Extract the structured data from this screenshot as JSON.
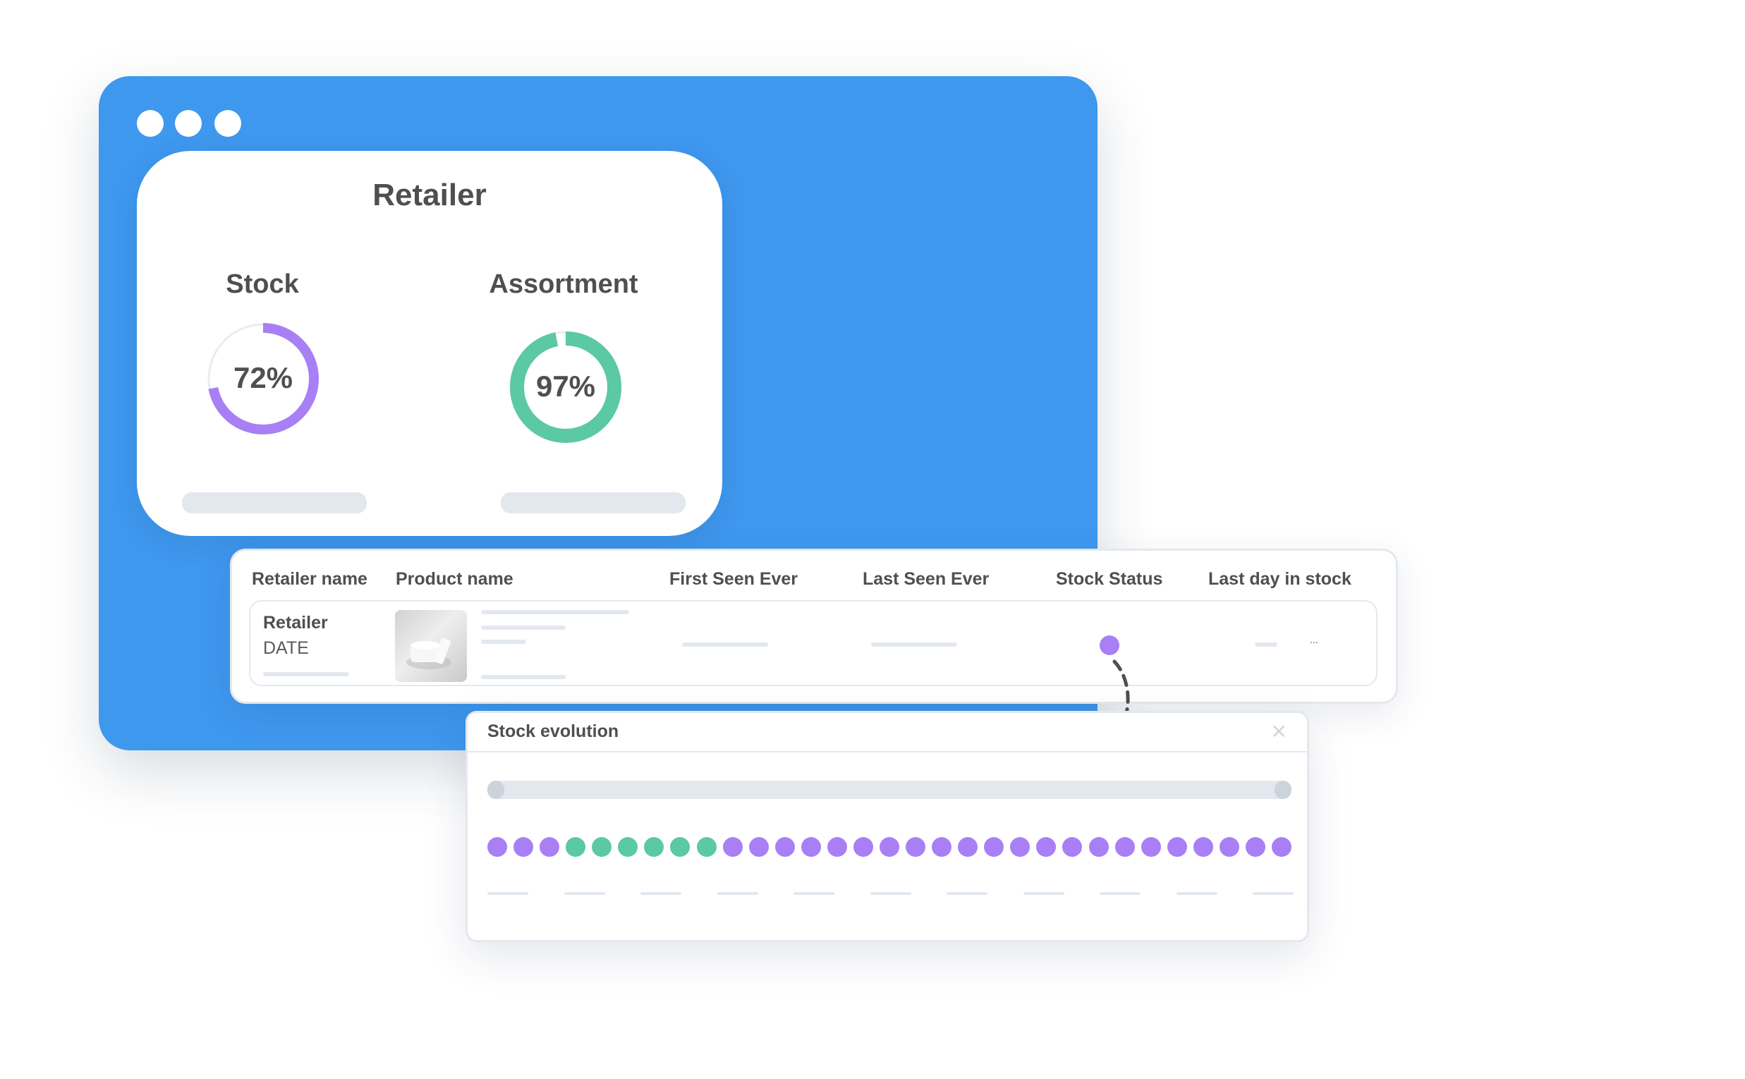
{
  "colors": {
    "window_bg": "#3e98ee",
    "stock_ring": "#a97ff5",
    "assortment_ring": "#5bc9a3",
    "status_purple": "#a97ff5",
    "status_green": "#5bc9a3"
  },
  "summary": {
    "title": "Retailer",
    "stock": {
      "label": "Stock",
      "value_text": "72%",
      "value": 72
    },
    "assortment": {
      "label": "Assortment",
      "value_text": "97%",
      "value": 97
    }
  },
  "table": {
    "headers": [
      "Retailer name",
      "Product name",
      "First Seen Ever",
      "Last Seen Ever",
      "Stock Status",
      "Last day in stock"
    ],
    "row": {
      "retailer": "Retailer",
      "date": "DATE",
      "stock_status_color": "purple",
      "more": "..."
    }
  },
  "popup": {
    "title": "Stock evolution",
    "close_icon": "close-icon",
    "evolution": [
      "purple",
      "purple",
      "purple",
      "green",
      "green",
      "green",
      "green",
      "green",
      "green",
      "purple",
      "purple",
      "purple",
      "purple",
      "purple",
      "purple",
      "purple",
      "purple",
      "purple",
      "purple",
      "purple",
      "purple",
      "purple",
      "purple",
      "purple",
      "purple",
      "purple",
      "purple",
      "purple",
      "purple",
      "purple",
      "purple"
    ]
  }
}
